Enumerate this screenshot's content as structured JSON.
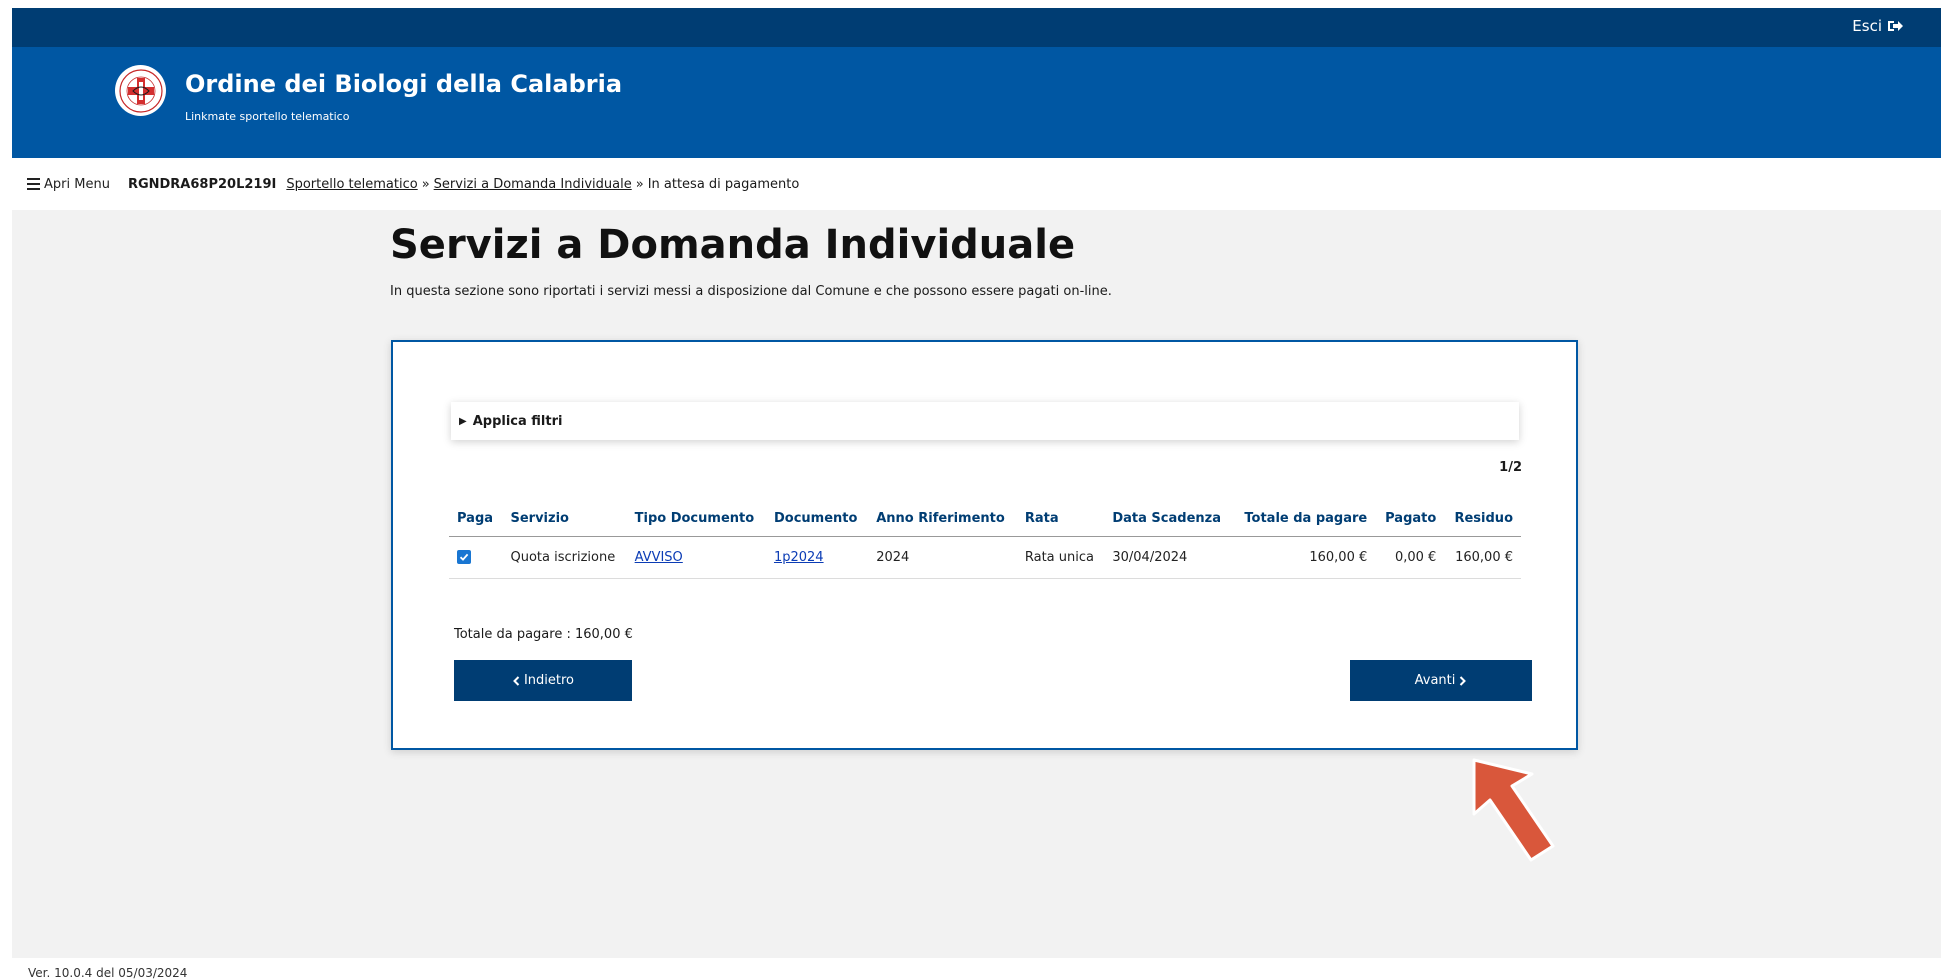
{
  "topbar": {
    "logout_label": "Esci",
    "logout_icon": "sign-out-icon"
  },
  "header": {
    "title": "Ordine dei Biologi della Calabria",
    "subtitle": "Linkmate sportello telematico",
    "logo_icon": "seal-icon"
  },
  "nav": {
    "menu_label": "Apri Menu",
    "menu_icon": "hamburger-icon",
    "user_code": "RGNDRA68P20L219I",
    "breadcrumb": {
      "item1": "Sportello telematico",
      "item2": "Servizi a Domanda Individuale",
      "current": "In attesa di pagamento",
      "separator": "»"
    }
  },
  "main": {
    "title": "Servizi a Domanda Individuale",
    "description": "In questa sezione sono riportati i servizi messi a disposizione dal Comune e che possono essere pagati on-line.",
    "filter_label": "Applica filtri",
    "pagination": "1/2",
    "table": {
      "headers": [
        "Paga",
        "Servizio",
        "Tipo Documento",
        "Documento",
        "Anno Riferimento",
        "Rata",
        "Data Scadenza",
        "Totale da pagare",
        "Pagato",
        "Residuo"
      ],
      "rows": [
        {
          "checked": true,
          "servizio": "Quota iscrizione",
          "tipo_documento": "AVVISO",
          "documento": "1p2024",
          "anno": "2024",
          "rata": "Rata unica",
          "scadenza": "30/04/2024",
          "totale": "160,00 €",
          "pagato": "0,00 €",
          "residuo": "160,00 €"
        }
      ]
    },
    "total_line": "Totale da pagare : 160,00 €",
    "back_label": "Indietro",
    "next_label": "Avanti"
  },
  "footer": {
    "version": "Ver. 10.0.4 del 05/03/2024"
  },
  "colors": {
    "topbar": "#003d73",
    "header": "#0057a3",
    "button": "#003d73",
    "table_header_text": "#003d73",
    "link": "#0b3cb5",
    "annotation_arrow": "#d9573b",
    "content_bg": "#f2f2f2"
  }
}
